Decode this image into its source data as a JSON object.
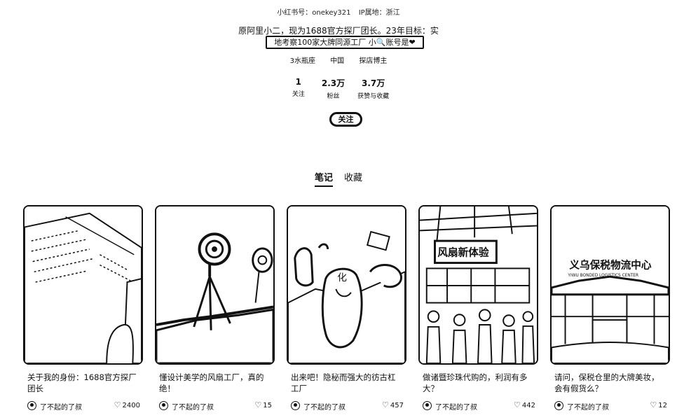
{
  "profile": {
    "id_label": "小红书号：onekey321",
    "ip_label": "IP属地：浙江",
    "bio_line": "原阿里小二，现为1688官方探厂团长。23年目标：实",
    "bio_box": "地考察100家大牌同源工厂 小🔍账号是❤",
    "tags": [
      "3水瓶座",
      "中国",
      "探店博主"
    ],
    "stats": [
      {
        "num": "1",
        "label": "关注"
      },
      {
        "num": "2.3万",
        "label": "粉丝"
      },
      {
        "num": "3.7万",
        "label": "获赞与收藏"
      }
    ],
    "follow_label": "关注"
  },
  "tabs": [
    {
      "label": "笔记",
      "active": true
    },
    {
      "label": "收藏",
      "active": false
    }
  ],
  "notes": [
    {
      "title": "关于我的身份：1688官方探厂团长",
      "author": "了不起的了叔",
      "likes": "2400"
    },
    {
      "title": "懂设计美学的风扇工厂，真的绝！",
      "author": "了不起的了叔",
      "likes": "15"
    },
    {
      "title": "出来吧！隐秘而强大的彷古杠工厂",
      "author": "了不起的了叔",
      "likes": "457"
    },
    {
      "title": "做诸暨珍珠代购的，利润有多大？",
      "author": "了不起的了叔",
      "likes": "442"
    },
    {
      "title": "请问，保税仓里的大牌美妆，会有假货么？",
      "author": "了不起的了叔",
      "likes": "12"
    }
  ],
  "thumb_texts": {
    "third_badge": "化",
    "fourth_sign": "风扇新体验",
    "fifth_sign": "义乌保税物流中心",
    "fifth_sign_en": "YIWU BONDED LOGISTICS CENTER"
  }
}
